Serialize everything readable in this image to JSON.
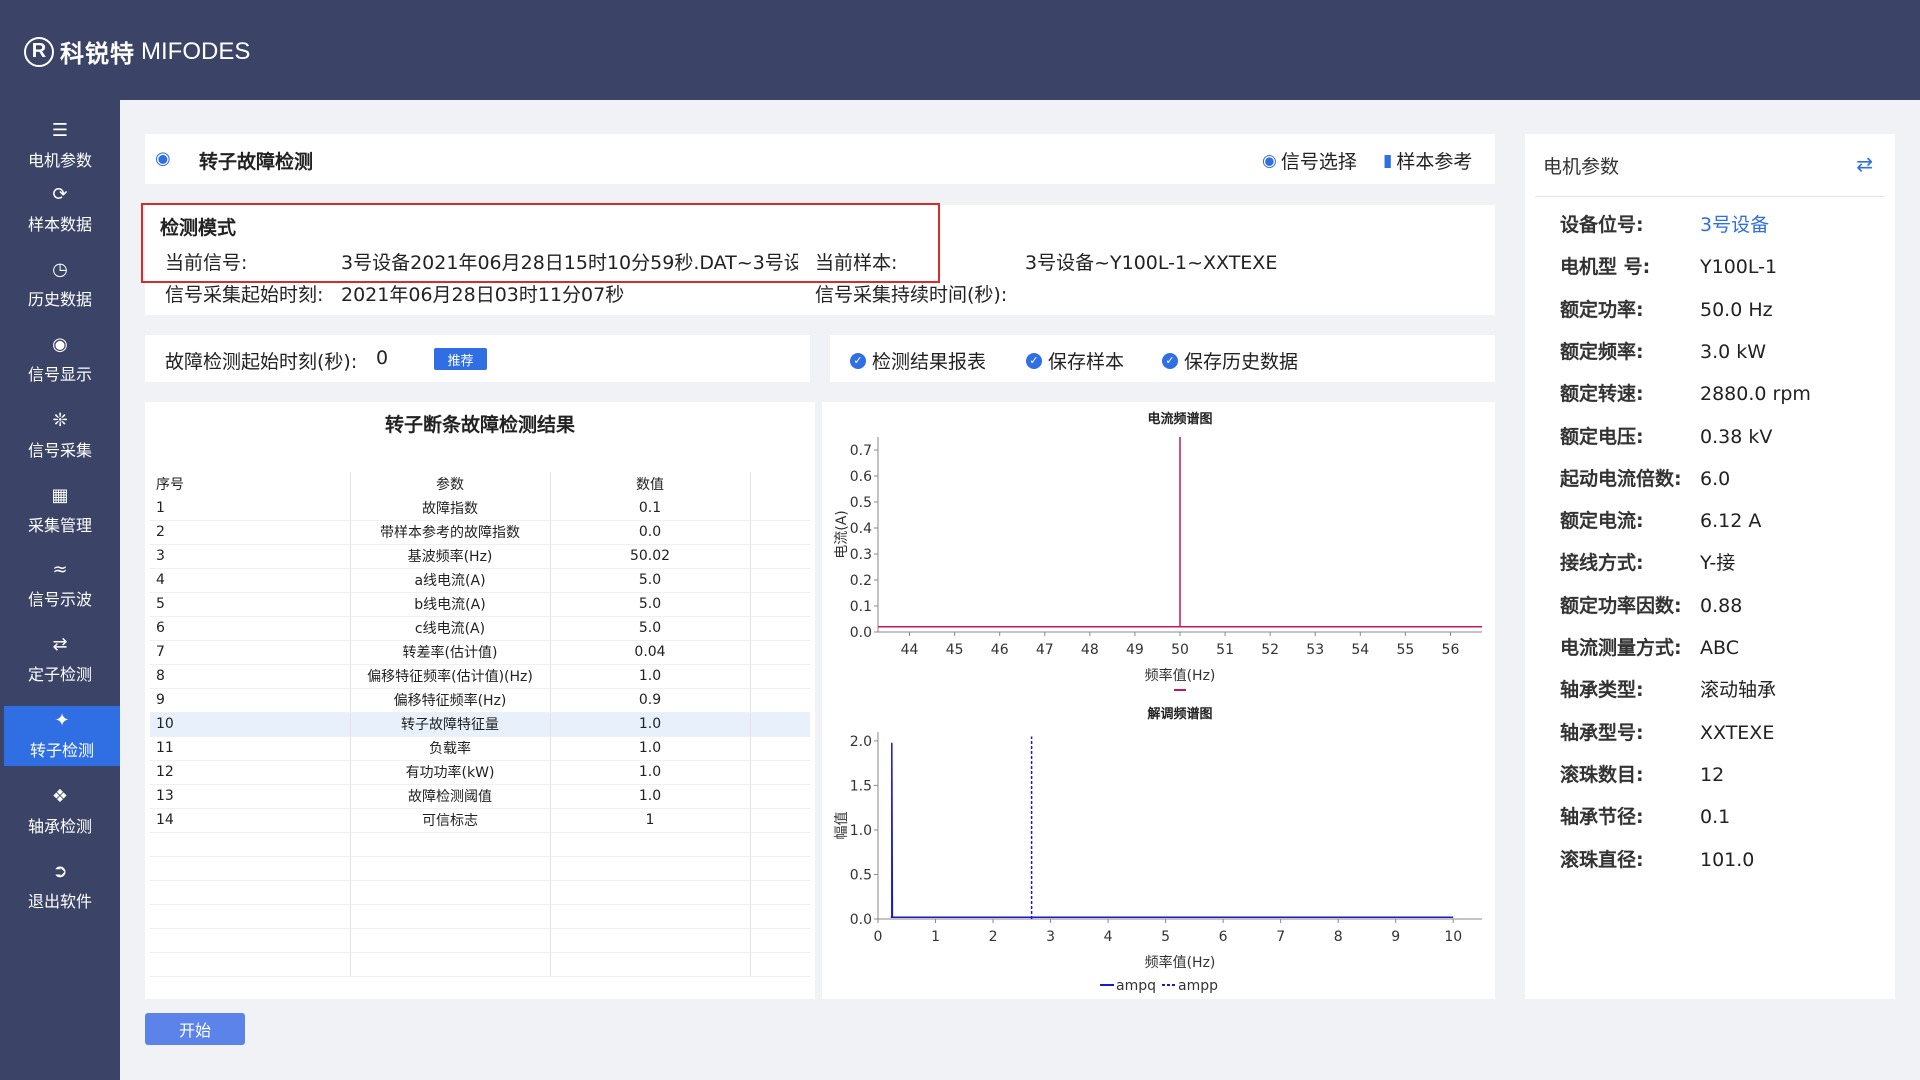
{
  "brand": {
    "mark": "R",
    "name_cn": "科锐特",
    "name_en": "MIFODES"
  },
  "nav": {
    "items": [
      {
        "label": "电机参数",
        "icon": "sliders-icon"
      },
      {
        "label": "样本数据",
        "icon": "refresh-icon"
      },
      {
        "label": "历史数据",
        "icon": "history-icon"
      },
      {
        "label": "信号显示",
        "icon": "eye-icon"
      },
      {
        "label": "信号采集",
        "icon": "antenna-icon"
      },
      {
        "label": "采集管理",
        "icon": "grid-icon"
      },
      {
        "label": "信号示波",
        "icon": "line-chart-icon"
      },
      {
        "label": "定子检测",
        "icon": "toggle-icon"
      },
      {
        "label": "转子检测",
        "icon": "rotor-icon"
      },
      {
        "label": "轴承检测",
        "icon": "bearing-icon"
      },
      {
        "label": "退出软件",
        "icon": "logout-icon"
      }
    ],
    "active": "转子检测"
  },
  "header": {
    "title": "转子故障检测",
    "signal_select": "信号选择",
    "sample_ref": "样本参考"
  },
  "mode": {
    "title": "检测模式",
    "current_signal_label": "当前信号:",
    "current_signal_value": "3号设备2021年06月28日15时10分59秒.DAT~3号设",
    "current_sample_label": "当前样本:",
    "current_sample_value": "3号设备~Y100L-1~XXTEXE",
    "start_time_label": "信号采集起始时刻:",
    "start_time_value": "2021年06月28日03时11分07秒",
    "duration_label": "信号采集持续时间(秒):"
  },
  "controls": {
    "fault_start_label": "故障检测起始时刻(秒):",
    "fault_start_value": "0",
    "recommend": "推荐",
    "checks": [
      "检测结果报表",
      "保存样本",
      "保存历史数据"
    ]
  },
  "result_table": {
    "title": "转子断条故障检测结果",
    "columns": [
      "序号",
      "参数",
      "数值"
    ],
    "rows": [
      [
        "1",
        "故障指数",
        "0.1"
      ],
      [
        "2",
        "带样本参考的故障指数",
        "0.0"
      ],
      [
        "3",
        "基波频率(Hz)",
        "50.02"
      ],
      [
        "4",
        "a线电流(A)",
        "5.0"
      ],
      [
        "5",
        "b线电流(A)",
        "5.0"
      ],
      [
        "6",
        "c线电流(A)",
        "5.0"
      ],
      [
        "7",
        "转差率(估计值)",
        "0.04"
      ],
      [
        "8",
        "偏移特征频率(估计值)(Hz)",
        "1.0"
      ],
      [
        "9",
        "偏移特征频率(Hz)",
        "0.9"
      ],
      [
        "10",
        "转子故障特征量",
        "1.0"
      ],
      [
        "11",
        "负载率",
        "1.0"
      ],
      [
        "12",
        "有功功率(kW)",
        "1.0"
      ],
      [
        "13",
        "故障检测阈值",
        "1.0"
      ],
      [
        "14",
        "可信标志",
        "1"
      ]
    ],
    "selected_row": 10
  },
  "chart_data": [
    {
      "type": "line",
      "title": "电流频谱图",
      "xlabel": "频率值(Hz)",
      "ylabel": "电流(A)",
      "xlim": [
        43.3,
        56.7
      ],
      "ylim": [
        0.0,
        0.75
      ],
      "xticks": [
        44,
        45,
        46,
        47,
        48,
        49,
        50,
        51,
        52,
        53,
        54,
        55,
        56
      ],
      "yticks": [
        0.0,
        0.1,
        0.2,
        0.3,
        0.4,
        0.5,
        0.6,
        0.7
      ],
      "series": [
        {
          "color": "#c2185b",
          "x": [
            43.3,
            50.0,
            50.0,
            50.0,
            50.05,
            56.7
          ],
          "y": [
            0.02,
            0.02,
            0.75,
            0.02,
            0.02,
            0.02
          ]
        }
      ]
    },
    {
      "type": "line",
      "title": "解调频谱图",
      "xlabel": "频率值(Hz)",
      "ylabel": "幅值",
      "xlim": [
        0,
        10.5
      ],
      "ylim": [
        0.0,
        2.1
      ],
      "xticks": [
        0,
        1,
        2,
        3,
        4,
        5,
        6,
        7,
        8,
        9,
        10
      ],
      "yticks": [
        0.0,
        0.5,
        1.0,
        1.5,
        2.0
      ],
      "series": [
        {
          "name": "ampq",
          "color": "#1a1acc",
          "style": "solid",
          "x": [
            0.22,
            0.24,
            0.24,
            0.25,
            10.0
          ],
          "y": [
            0.02,
            0.02,
            1.98,
            0.02,
            0.02
          ]
        },
        {
          "name": "ampp",
          "color": "#1a1acc",
          "style": "dashed",
          "x": [
            2.67,
            2.67
          ],
          "y": [
            0.0,
            2.05
          ]
        }
      ]
    }
  ],
  "motor_params": {
    "title": "电机参数",
    "rows": [
      {
        "label": "设备位号:",
        "value": "3号设备",
        "link": true
      },
      {
        "label": "电机型 号:",
        "value": "Y100L-1"
      },
      {
        "label": "额定功率:",
        "value": "50.0 Hz"
      },
      {
        "label": "额定频率:",
        "value": "3.0 kW"
      },
      {
        "label": "额定转速:",
        "value": "2880.0 rpm"
      },
      {
        "label": "额定电压:",
        "value": "0.38 kV"
      },
      {
        "label": "起动电流倍数:",
        "value": "6.0"
      },
      {
        "label": "额定电流:",
        "value": "6.12 A"
      },
      {
        "label": "接线方式:",
        "value": "Y-接"
      },
      {
        "label": "额定功率因数:",
        "value": "0.88"
      },
      {
        "label": "电流测量方式:",
        "value": "ABC"
      },
      {
        "label": "轴承类型:",
        "value": "滚动轴承"
      },
      {
        "label": "轴承型号:",
        "value": "XXTEXE"
      },
      {
        "label": "滚珠数目:",
        "value": "12"
      },
      {
        "label": "轴承节径:",
        "value": "0.1"
      },
      {
        "label": "滚珠直径:",
        "value": "101.0"
      }
    ]
  },
  "start_button": "开始",
  "colors": {
    "sidebar": "#3b4466",
    "accent": "#2f6fe3",
    "highlight": "#d92b2b"
  }
}
